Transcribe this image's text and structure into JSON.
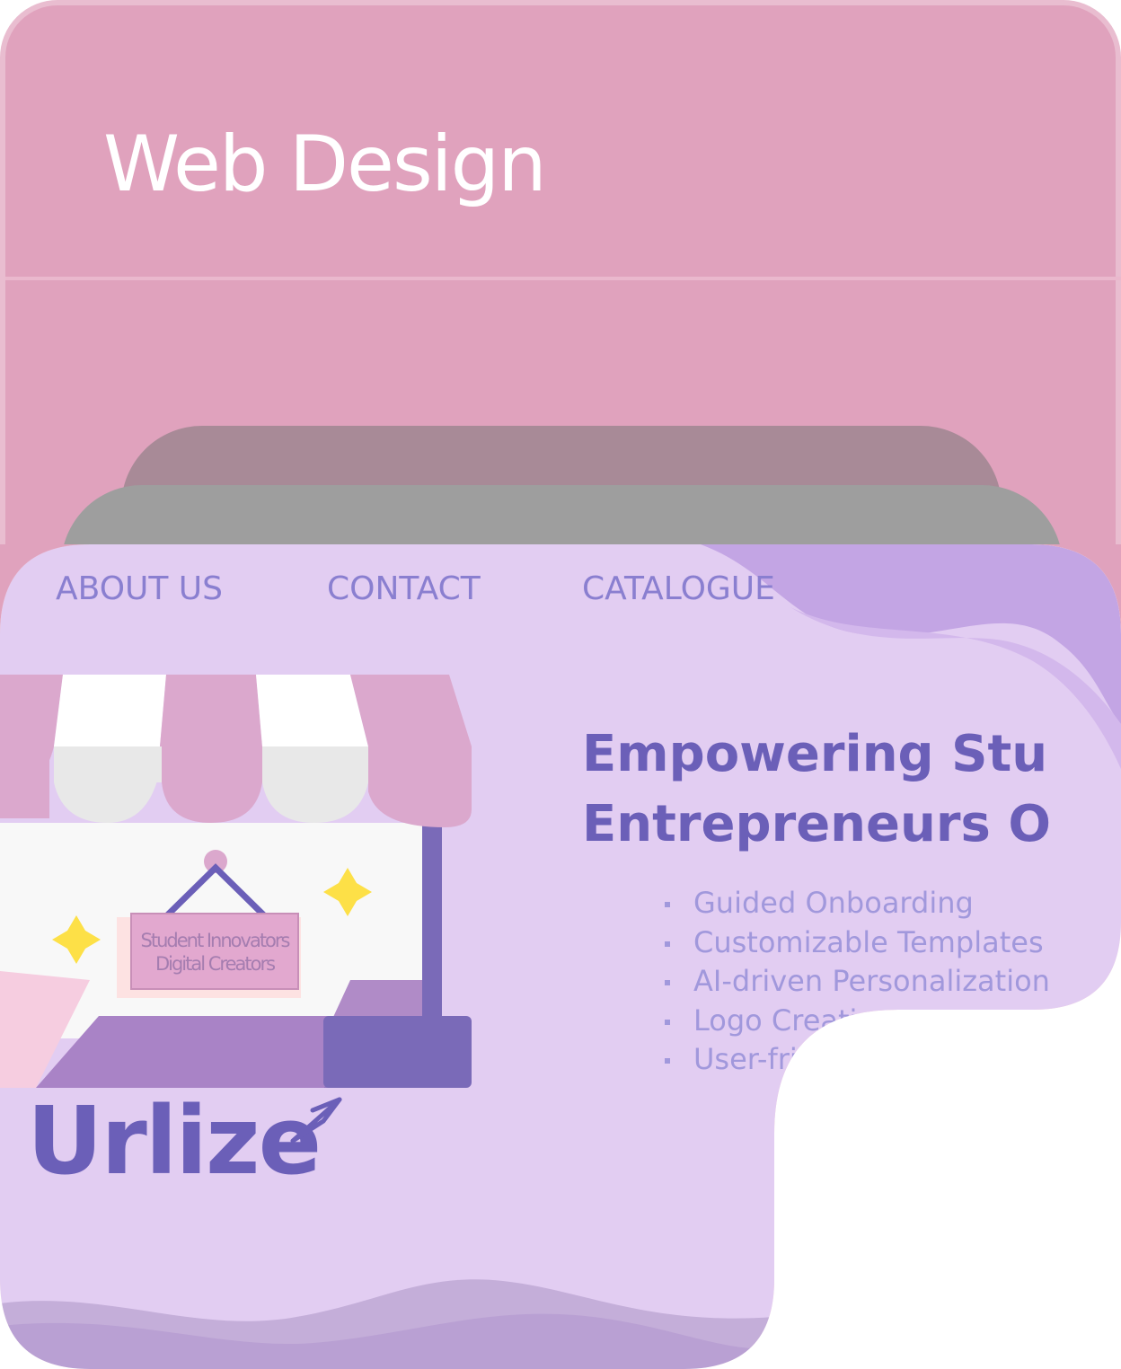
{
  "card": {
    "title": "Web Design"
  },
  "preview": {
    "nav": {
      "about": "ABOUT US",
      "contact": "CONTACT",
      "catalogue": "CATALOGUE"
    },
    "heading_line1": "Empowering Stu",
    "heading_line2": "Entrepreneurs O",
    "features": [
      "Guided Onboarding",
      "Customizable Templates",
      "AI-driven Personalization",
      "Logo Creatio",
      "User-frie"
    ],
    "sign_line1": "Student Innovators",
    "sign_line2": "Digital Creators",
    "logo_text": "Urlize"
  },
  "colors": {
    "card_bg": "#e0a2bd",
    "preview_bg": "#e2cdf2",
    "accent_purple": "#6b5fb8",
    "awning_pink": "#dba8cd",
    "star_yellow": "#fde047"
  },
  "icons": {
    "logo_arrow": "paper-plane-icon",
    "sparkles": "star-icon"
  }
}
